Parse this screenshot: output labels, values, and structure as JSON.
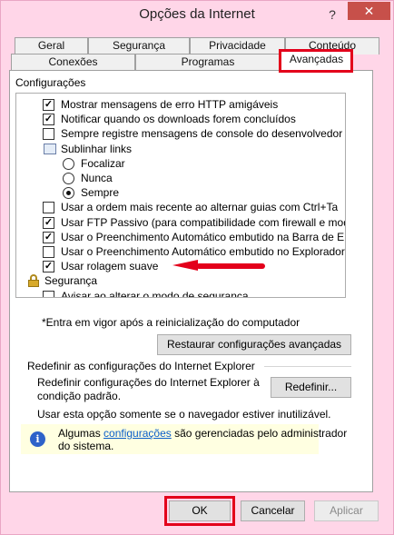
{
  "window": {
    "title": "Opções da Internet",
    "help_symbol": "?",
    "close_symbol": "✕"
  },
  "tabs": {
    "row1": [
      "Geral",
      "Segurança",
      "Privacidade",
      "Conteúdo"
    ],
    "row2": [
      "Conexões",
      "Programas",
      "Avançadas"
    ],
    "active": "Avançadas"
  },
  "settings": {
    "group_label": "Configurações",
    "items": [
      {
        "type": "checkbox",
        "checked": true,
        "label": "Mostrar mensagens de erro HTTP amigáveis"
      },
      {
        "type": "checkbox",
        "checked": true,
        "label": "Notificar quando os downloads forem concluídos"
      },
      {
        "type": "checkbox",
        "checked": false,
        "label": "Sempre registre mensagens de console do desenvolvedor"
      },
      {
        "type": "group",
        "label": "Sublinhar links"
      },
      {
        "type": "radio",
        "checked": false,
        "label": "Focalizar"
      },
      {
        "type": "radio",
        "checked": false,
        "label": "Nunca"
      },
      {
        "type": "radio",
        "checked": true,
        "label": "Sempre"
      },
      {
        "type": "checkbox",
        "checked": false,
        "label": "Usar a ordem mais recente ao alternar guias com  Ctrl+Ta"
      },
      {
        "type": "checkbox",
        "checked": true,
        "label": "Usar FTP Passivo (para compatibilidade com firewall e mod"
      },
      {
        "type": "checkbox",
        "checked": true,
        "label": "Usar o Preenchimento Automático embutido na Barra de E"
      },
      {
        "type": "checkbox",
        "checked": false,
        "label": "Usar o Preenchimento Automático embutido no Explorador"
      },
      {
        "type": "checkbox",
        "checked": true,
        "label": "Usar rolagem suave"
      },
      {
        "type": "lockgroup",
        "label": "Segurança"
      },
      {
        "type": "checkbox",
        "checked": false,
        "label": "Avisar ao alterar o modo de segurança"
      }
    ],
    "note": "*Entra em vigor após a reinicialização do computador",
    "restore_button": "Restaurar configurações avançadas"
  },
  "reset": {
    "section_title": "Redefinir as configurações do Internet Explorer",
    "description_line1": "Redefinir configurações do Internet Explorer à",
    "description_line2": "condição padrão.",
    "button": "Redefinir...",
    "warning": "Usar esta opção somente se o navegador estiver inutilizável."
  },
  "info": {
    "icon": "info-icon",
    "text_before": "Algumas ",
    "link": "configurações",
    "text_after": " são gerenciadas pelo administrador",
    "line2": "do sistema."
  },
  "buttons": {
    "ok": "OK",
    "cancel": "Cancelar",
    "apply": "Aplicar"
  },
  "colors": {
    "highlight": "#e3001b",
    "close": "#c7504a",
    "link": "#0b5ec9"
  }
}
